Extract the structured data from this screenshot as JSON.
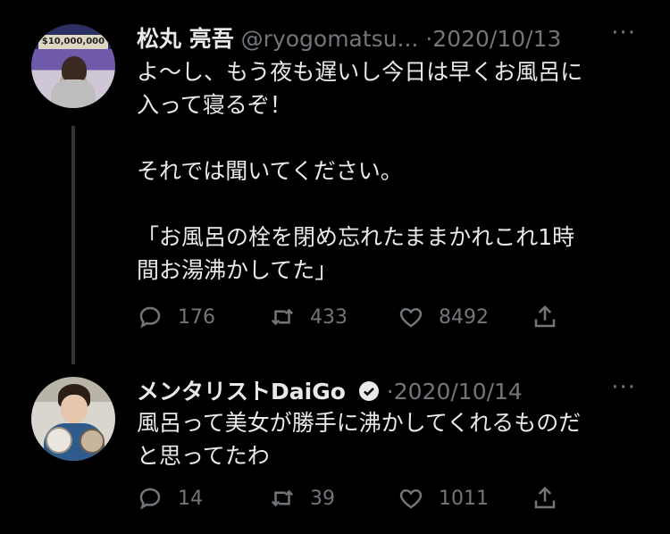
{
  "tweets": [
    {
      "name": "松丸 亮吾",
      "handle": "@ryogomatsu...",
      "date": "2020/10/13",
      "avatar_text": "$10,000,000",
      "text": "よ〜し、もう夜も遅いし今日は早くお風呂に\n入って寝るぞ！\n\nそれでは聞いてください。\n\n「お風呂の栓を閉め忘れたままかれこれ1時\n間お湯沸かしてた」",
      "replies": "176",
      "retweets": "433",
      "likes": "8492",
      "more": "···"
    },
    {
      "name": "メンタリストDaiGo",
      "date": "2020/10/14",
      "text": "風呂って美女が勝手に沸かしてくれるものだ\nと思ってたわ",
      "replies": "14",
      "retweets": "39",
      "likes": "1011",
      "more": "···"
    }
  ],
  "separator": "·",
  "icons": [
    "reply-icon",
    "retweet-icon",
    "like-icon",
    "share-icon",
    "verified-badge-icon",
    "more-icon"
  ],
  "colors": {
    "background": "#000000",
    "text": "#e7e9ea",
    "muted": "#71767b"
  }
}
